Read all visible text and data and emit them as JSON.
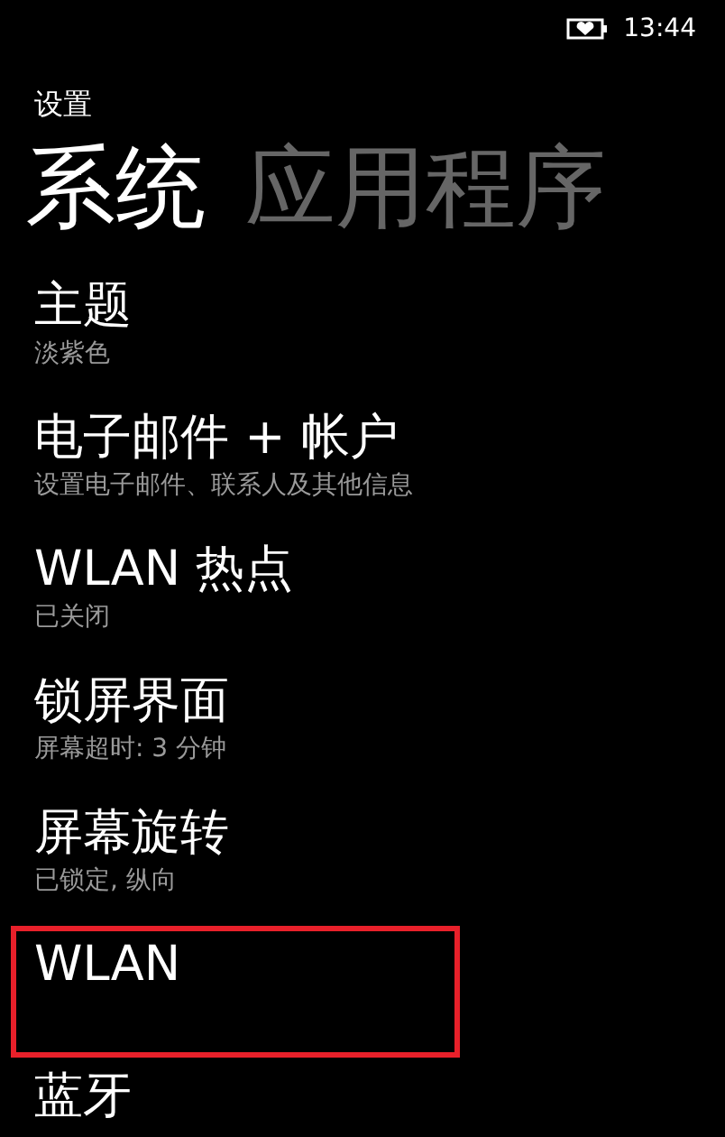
{
  "status_bar": {
    "time": "13:44"
  },
  "app_title": "设置",
  "pivots": [
    {
      "label": "系统",
      "selected": true
    },
    {
      "label": "应用程序",
      "selected": false
    }
  ],
  "items": [
    {
      "title": "主题",
      "subtitle": "淡紫色",
      "highlighted": false
    },
    {
      "title": "电子邮件 + 帐户",
      "subtitle": "设置电子邮件、联系人及其他信息",
      "highlighted": false
    },
    {
      "title": "WLAN 热点",
      "subtitle": "已关闭",
      "highlighted": false
    },
    {
      "title": "锁屏界面",
      "subtitle": "屏幕超时: 3 分钟",
      "highlighted": false
    },
    {
      "title": "屏幕旋转",
      "subtitle": "已锁定, 纵向",
      "highlighted": false
    },
    {
      "title": "WLAN",
      "highlighted": true
    },
    {
      "title": "蓝牙",
      "highlighted": false
    }
  ]
}
